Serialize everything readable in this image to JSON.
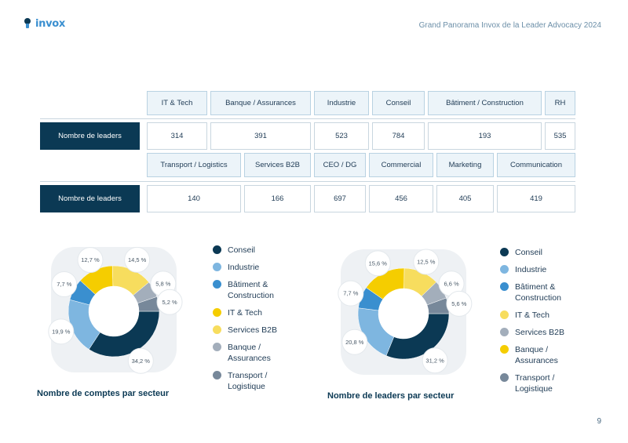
{
  "brand": {
    "logo_text": "invox"
  },
  "header": {
    "title": "Grand Panorama Invox de la Leader Advocacy 2024"
  },
  "page": {
    "number": "9"
  },
  "table1": {
    "row_label": "Nombre de leaders",
    "headers": [
      "IT & Tech",
      "Banque / Assurances",
      "Industrie",
      "Conseil",
      "Bâtiment / Construction",
      "RH"
    ],
    "values": [
      "314",
      "391",
      "523",
      "784",
      "193",
      "535"
    ]
  },
  "table2": {
    "row_label": "Nombre de leaders",
    "headers": [
      "Transport / Logistics",
      "Services B2B",
      "CEO / DG",
      "Commercial",
      "Marketing",
      "Communication"
    ],
    "values": [
      "140",
      "166",
      "697",
      "456",
      "405",
      "419"
    ]
  },
  "colors": {
    "Conseil": "#0b3954",
    "Industrie": "#7eb6e0",
    "Batiment": "#3a8fcf",
    "IT": "#f5cd00",
    "ServicesB2B": "#f7dd5e",
    "Banque": "#a3aebb",
    "Transport": "#77889a"
  },
  "legend_left": [
    "Conseil",
    "Industrie",
    "Bâtiment & Construction",
    "IT & Tech",
    "Services B2B",
    "Banque / Assurances",
    "Transport / Logistique"
  ],
  "legend_right": [
    "Conseil",
    "Industrie",
    "Bâtiment & Construction",
    "IT & Tech",
    "Services B2B",
    "Banque / Assurances",
    "Transport / Logistique"
  ],
  "chart_data": [
    {
      "type": "pie",
      "title": "Nombre de comptes par secteur",
      "labels": [
        "Conseil",
        "Industrie",
        "Bâtiment & Construction",
        "IT & Tech",
        "Services B2B",
        "Banque / Assurances",
        "Transport / Logistique"
      ],
      "values": [
        34.2,
        19.9,
        7.7,
        12.7,
        14.5,
        5.8,
        5.2
      ],
      "value_labels": [
        "34,2 %",
        "19,9 %",
        "7,7 %",
        "12,7 %",
        "14,5 %",
        "5,8 %",
        "5,2 %"
      ]
    },
    {
      "type": "pie",
      "title": "Nombre de leaders par secteur",
      "labels": [
        "Conseil",
        "Industrie",
        "Bâtiment & Construction",
        "Banque / Assurances",
        "IT & Tech",
        "Services B2B",
        "Transport / Logistique"
      ],
      "values": [
        31.2,
        20.8,
        7.7,
        15.6,
        12.5,
        6.6,
        5.6
      ],
      "value_labels": [
        "31,2 %",
        "20,8 %",
        "7,7 %",
        "15,6 %",
        "12,5 %",
        "6,6 %",
        "5,6 %"
      ]
    }
  ]
}
